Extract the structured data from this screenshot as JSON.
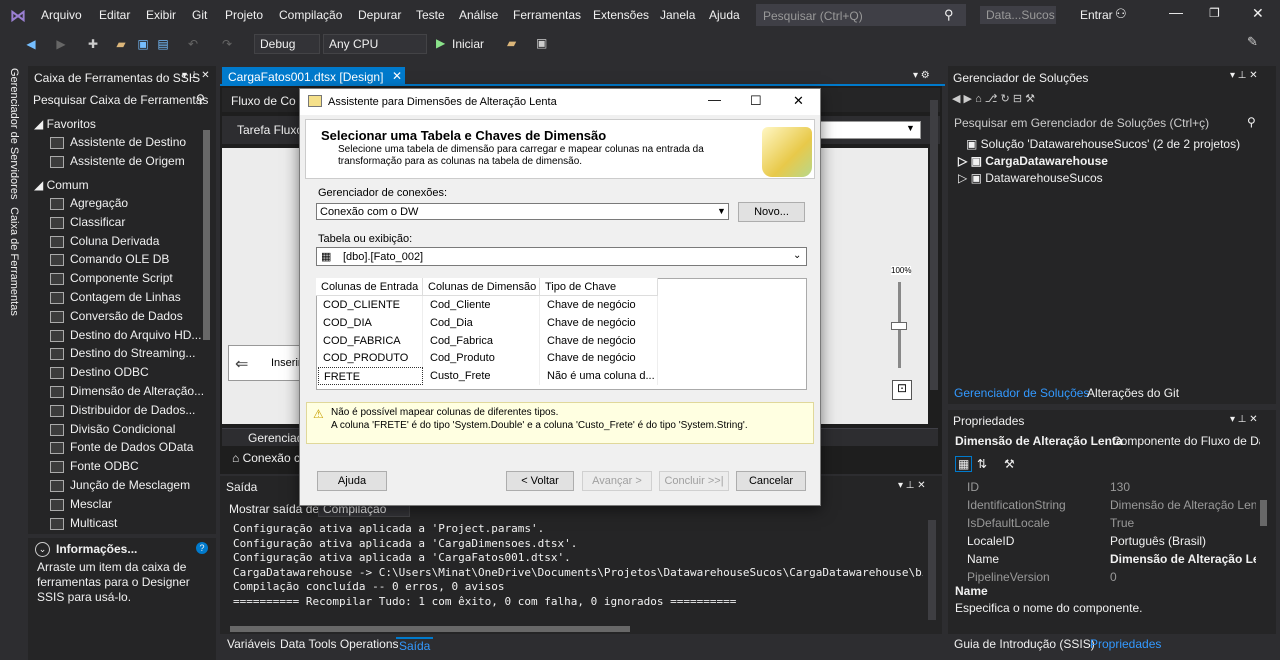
{
  "menu": [
    "Arquivo",
    "Editar",
    "Exibir",
    "Git",
    "Projeto",
    "Compilação",
    "Depurar",
    "Teste",
    "Análise",
    "Ferramentas",
    "Extensões",
    "Janela",
    "Ajuda"
  ],
  "search_placeholder": "Pesquisar (Ctrl+Q)",
  "solution_name_short": "Data...Sucos",
  "signin_label": "Entrar",
  "toolbar": {
    "config": "Debug",
    "platform": "Any CPU",
    "start_label": "Iniciar"
  },
  "side_tabs": {
    "server_explorer": "Gerenciador de Servidores",
    "toolbox": "Caixa de Ferramentas"
  },
  "toolbox": {
    "title": "Caixa de Ferramentas do SSIS",
    "search": "Pesquisar Caixa de Ferramentas",
    "favorites_label": "Favoritos",
    "favorites": [
      "Assistente de Destino",
      "Assistente de Origem"
    ],
    "common_label": "Comum",
    "common": [
      "Agregação",
      "Classificar",
      "Coluna Derivada",
      "Comando OLE DB",
      "Componente Script",
      "Contagem de Linhas",
      "Conversão de Dados",
      "Destino do Arquivo HD...",
      "Destino do Streaming...",
      "Destino ODBC",
      "Dimensão de Alteração...",
      "Distribuidor de Dados...",
      "Divisão Condicional",
      "Fonte de Dados OData",
      "Fonte ODBC",
      "Junção de Mesclagem",
      "Mesclar",
      "Multicast"
    ]
  },
  "info": {
    "title": "Informações...",
    "text": "Arraste um item da caixa de ferramentas para o Designer SSIS para usá-lo."
  },
  "doc_tab": "CargaFatos001.dtsx [Design]",
  "designer": {
    "tab_label": "Fluxo de Co",
    "task_label": "Tarefa Fluxo d",
    "insert_label": "Inserir",
    "conn_tab": "Gerenciado",
    "conn_item": "Conexão co",
    "zoom": "100%"
  },
  "dialog": {
    "title": "Assistente para Dimensões de Alteração Lenta",
    "heading": "Selecionar uma Tabela e Chaves de Dimensão",
    "description": "Selecione uma tabela de dimensão para carregar e mapear colunas na entrada da transformação para as colunas na tabela de dimensão.",
    "conn_label": "Gerenciador de conexões:",
    "conn_value": "Conexão com o DW",
    "new_button": "Novo...",
    "table_label": "Tabela ou exibição:",
    "table_value": "[dbo].[Fato_002]",
    "columns": [
      "Colunas de Entrada",
      "Colunas de Dimensão",
      "Tipo de Chave"
    ],
    "rows": [
      [
        "COD_CLIENTE",
        "Cod_Cliente",
        "Chave de negócio"
      ],
      [
        "COD_DIA",
        "Cod_Dia",
        "Chave de negócio"
      ],
      [
        "COD_FABRICA",
        "Cod_Fabrica",
        "Chave de negócio"
      ],
      [
        "COD_PRODUTO",
        "Cod_Produto",
        "Chave de negócio"
      ],
      [
        "FRETE",
        "Custo_Frete",
        "Não é uma coluna d..."
      ]
    ],
    "warning_1": "Não é possível mapear colunas de diferentes tipos.",
    "warning_2": "A coluna 'FRETE' é do tipo 'System.Double' e a coluna 'Custo_Frete' é do tipo 'System.String'.",
    "buttons": {
      "help": "Ajuda",
      "back": "< Voltar",
      "next": "Avançar >",
      "finish": "Concluir >>|",
      "cancel": "Cancelar"
    }
  },
  "output": {
    "title": "Saída",
    "show_from_label": "Mostrar saída de:",
    "show_from_value": "Compilação",
    "lines": [
      "Configuração ativa aplicada a 'Project.params'.",
      "Configuração ativa aplicada a 'CargaDimensoes.dtsx'.",
      "Configuração ativa aplicada a 'CargaFatos001.dtsx'.",
      "CargaDatawarehouse -> C:\\Users\\Minat\\OneDrive\\Documents\\Projetos\\DatawarehouseSucos\\CargaDatawarehouse\\bi",
      "Compilação concluída -- 0 erros, 0 avisos",
      "========== Recompilar Tudo: 1 com êxito, 0 com falha, 0 ignorados =========="
    ]
  },
  "bottom_tabs": [
    "Variáveis",
    "Data Tools Operations",
    "Saída"
  ],
  "solution": {
    "title": "Gerenciador de Soluções",
    "search": "Pesquisar em Gerenciador de Soluções (Ctrl+ç)",
    "root": "Solução 'DatawarehouseSucos' (2 de 2 projetos)",
    "projects": [
      "CargaDatawarehouse",
      "DatawarehouseSucos"
    ],
    "tabs": [
      "Gerenciador de Soluções",
      "Alterações do Git"
    ]
  },
  "properties": {
    "title": "Propriedades",
    "object": "Dimensão de Alteração Lenta",
    "object_type": "Componente do Fluxo de Dac",
    "rows": [
      [
        "ID",
        "130"
      ],
      [
        "IdentificationString",
        "Dimensão de Alteração Lenta"
      ],
      [
        "IsDefaultLocale",
        "True"
      ],
      [
        "LocaleID",
        "Português (Brasil)"
      ],
      [
        "Name",
        "Dimensão de Alteração Lenta"
      ],
      [
        "PipelineVersion",
        "0"
      ]
    ],
    "desc_title": "Name",
    "desc_text": "Especifica o nome do componente.",
    "tabs": [
      "Guia de Introdução (SSIS)",
      "Propriedades"
    ]
  },
  "colors": {
    "accent": "#007acc",
    "bg": "#2d2d30",
    "panel": "#252526"
  }
}
